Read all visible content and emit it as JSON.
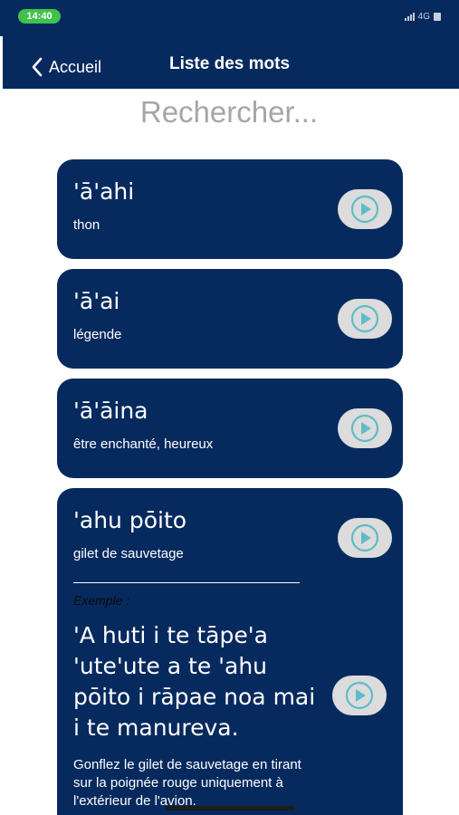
{
  "status_bar": {
    "time": "14:40",
    "network": "4G"
  },
  "nav": {
    "back_label": "Accueil",
    "title": "Liste des mots"
  },
  "search": {
    "placeholder": "Rechercher..."
  },
  "words": [
    {
      "word": "'ā'ahi",
      "translation": "thon"
    },
    {
      "word": "'ā'ai",
      "translation": "légende"
    },
    {
      "word": "'ā'āina",
      "translation": "être enchanté, heureux"
    },
    {
      "word": "'ahu pōito",
      "translation": "gilet de sauvetage",
      "example_label": "Exemple :",
      "example_sentence": "'A huti i te tāpe'a 'ute'ute a te 'ahu pōito i rāpae noa mai i te manureva.",
      "example_translation": "Gonflez le gilet de sauvetage en tirant sur la poignée rouge uniquement à l'extérieur de l'avion."
    }
  ],
  "icons": {
    "back": "chevron-left-icon",
    "play": "play-circle-icon",
    "signal": "signal-icon",
    "battery": "battery-icon"
  },
  "colors": {
    "primary": "#072a5e",
    "status_green": "#3fc24a",
    "play_bg": "#dcdcdc",
    "play_accent": "#5fbcc6"
  }
}
